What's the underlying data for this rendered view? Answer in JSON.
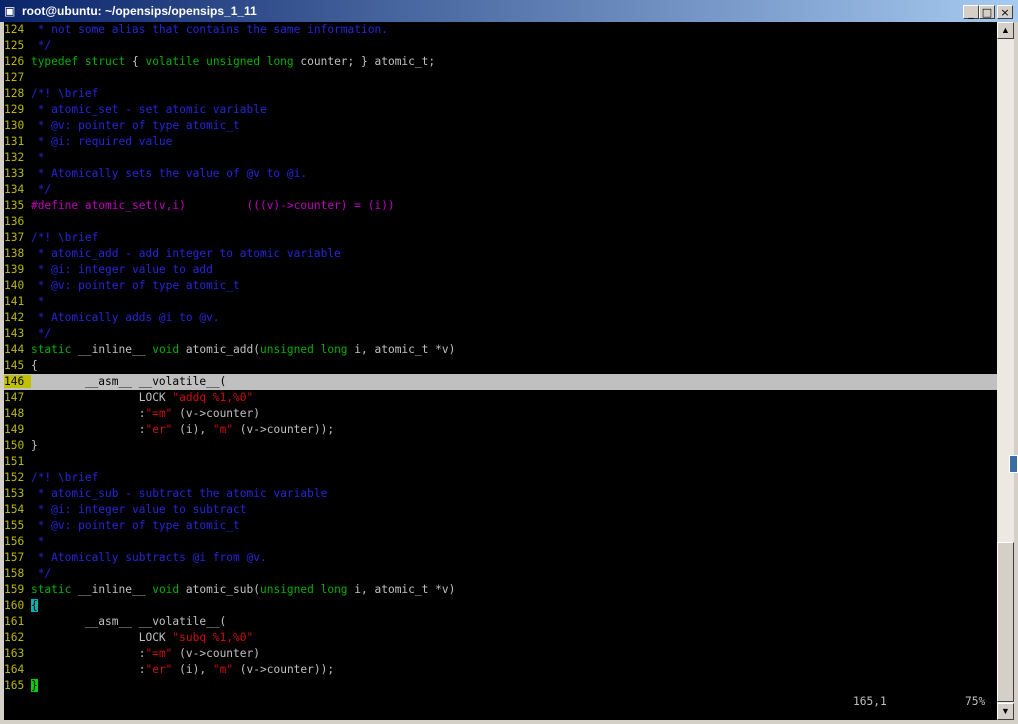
{
  "window": {
    "title": "root@ubuntu: ~/opensips/opensips_1_11",
    "icon": "terminal-icon",
    "buttons": {
      "minimize": "_",
      "maximize": "□",
      "close": "×"
    }
  },
  "editor": {
    "cursor_line": "146",
    "lines": [
      [
        [
          "124 ",
          "ln"
        ],
        [
          " * not some alias that contains the same information.",
          "c"
        ]
      ],
      [
        [
          "125 ",
          "ln"
        ],
        [
          " */",
          "c"
        ]
      ],
      [
        [
          "126 ",
          "ln"
        ],
        [
          "typedef struct",
          "k"
        ],
        [
          " { ",
          ""
        ],
        [
          "volatile unsigned long",
          "k"
        ],
        [
          " counter; } atomic_t;",
          ""
        ]
      ],
      [
        [
          "127 ",
          "ln"
        ]
      ],
      [
        [
          "128 ",
          "ln"
        ],
        [
          "/*! \\brief",
          "c"
        ]
      ],
      [
        [
          "129 ",
          "ln"
        ],
        [
          " * atomic_set - set atomic variable",
          "c"
        ]
      ],
      [
        [
          "130 ",
          "ln"
        ],
        [
          " * @v: pointer of type atomic_t",
          "c"
        ]
      ],
      [
        [
          "131 ",
          "ln"
        ],
        [
          " * @i: required value",
          "c"
        ]
      ],
      [
        [
          "132 ",
          "ln"
        ],
        [
          " *",
          "c"
        ]
      ],
      [
        [
          "133 ",
          "ln"
        ],
        [
          " * Atomically sets the value of @v to @i.",
          "c"
        ]
      ],
      [
        [
          "134 ",
          "ln"
        ],
        [
          " */",
          "c"
        ]
      ],
      [
        [
          "135 ",
          "ln"
        ],
        [
          "#define atomic_set(v,i)         (((v)->counter) = (i))",
          "p"
        ]
      ],
      [
        [
          "136 ",
          "ln"
        ]
      ],
      [
        [
          "137 ",
          "ln"
        ],
        [
          "/*! \\brief",
          "c"
        ]
      ],
      [
        [
          "138 ",
          "ln"
        ],
        [
          " * atomic_add - add integer to atomic variable",
          "c"
        ]
      ],
      [
        [
          "139 ",
          "ln"
        ],
        [
          " * @i: integer value to add",
          "c"
        ]
      ],
      [
        [
          "140 ",
          "ln"
        ],
        [
          " * @v: pointer of type atomic_t",
          "c"
        ]
      ],
      [
        [
          "141 ",
          "ln"
        ],
        [
          " *",
          "c"
        ]
      ],
      [
        [
          "142 ",
          "ln"
        ],
        [
          " * Atomically adds @i to @v.",
          "c"
        ]
      ],
      [
        [
          "143 ",
          "ln"
        ],
        [
          " */",
          "c"
        ]
      ],
      [
        [
          "144 ",
          "ln"
        ],
        [
          "static",
          "k"
        ],
        [
          " __inline__ ",
          ""
        ],
        [
          "void",
          "k"
        ],
        [
          " atomic_add(",
          ""
        ],
        [
          "unsigned long",
          "k"
        ],
        [
          " i, atomic_t *v)",
          ""
        ]
      ],
      [
        [
          "145 ",
          "ln"
        ],
        [
          "{",
          ""
        ]
      ],
      [
        [
          "146 ",
          "ln"
        ],
        [
          "        __asm__ __volatile__(",
          ""
        ]
      ],
      [
        [
          "147 ",
          "ln"
        ],
        [
          "                LOCK ",
          ""
        ],
        [
          "\"addq %1,%0\"",
          "s"
        ]
      ],
      [
        [
          "148 ",
          "ln"
        ],
        [
          "                :",
          ""
        ],
        [
          "\"=m\"",
          "s"
        ],
        [
          " (v->counter)",
          ""
        ]
      ],
      [
        [
          "149 ",
          "ln"
        ],
        [
          "                :",
          ""
        ],
        [
          "\"er\"",
          "s"
        ],
        [
          " (i), ",
          ""
        ],
        [
          "\"m\"",
          "s"
        ],
        [
          " (v->counter));",
          ""
        ]
      ],
      [
        [
          "150 ",
          "ln"
        ],
        [
          "}",
          ""
        ]
      ],
      [
        [
          "151 ",
          "ln"
        ]
      ],
      [
        [
          "152 ",
          "ln"
        ],
        [
          "/*! \\brief",
          "c"
        ]
      ],
      [
        [
          "153 ",
          "ln"
        ],
        [
          " * atomic_sub - subtract the atomic variable",
          "c"
        ]
      ],
      [
        [
          "154 ",
          "ln"
        ],
        [
          " * @i: integer value to subtract",
          "c"
        ]
      ],
      [
        [
          "155 ",
          "ln"
        ],
        [
          " * @v: pointer of type atomic_t",
          "c"
        ]
      ],
      [
        [
          "156 ",
          "ln"
        ],
        [
          " *",
          "c"
        ]
      ],
      [
        [
          "157 ",
          "ln"
        ],
        [
          " * Atomically subtracts @i from @v.",
          "c"
        ]
      ],
      [
        [
          "158 ",
          "ln"
        ],
        [
          " */",
          "c"
        ]
      ],
      [
        [
          "159 ",
          "ln"
        ],
        [
          "static",
          "k"
        ],
        [
          " __inline__ ",
          ""
        ],
        [
          "void",
          "k"
        ],
        [
          " atomic_sub(",
          ""
        ],
        [
          "unsigned long",
          "k"
        ],
        [
          " i, atomic_t *v)",
          ""
        ]
      ],
      [
        [
          "160 ",
          "ln"
        ],
        [
          "{",
          "cb1"
        ]
      ],
      [
        [
          "161 ",
          "ln"
        ],
        [
          "        __asm__ __volatile__(",
          ""
        ]
      ],
      [
        [
          "162 ",
          "ln"
        ],
        [
          "                LOCK ",
          ""
        ],
        [
          "\"subq %1,%0\"",
          "s"
        ]
      ],
      [
        [
          "163 ",
          "ln"
        ],
        [
          "                :",
          ""
        ],
        [
          "\"=m\"",
          "s"
        ],
        [
          " (v->counter)",
          ""
        ]
      ],
      [
        [
          "164 ",
          "ln"
        ],
        [
          "                :",
          ""
        ],
        [
          "\"er\"",
          "s"
        ],
        [
          " (i), ",
          ""
        ],
        [
          "\"m\"",
          "s"
        ],
        [
          " (v->counter));",
          ""
        ]
      ],
      [
        [
          "165 ",
          "ln"
        ],
        [
          "}",
          "cb2"
        ]
      ]
    ]
  },
  "statusline": {
    "position": "165,1",
    "percent": "75%"
  },
  "scrollbar": {
    "up_icon": "arrow-up-icon",
    "down_icon": "arrow-down-icon"
  },
  "colors": {
    "comment": "#2626d8",
    "keyword": "#00b300",
    "string": "#cc1010",
    "preproc": "#c000c0",
    "linenumber": "#b9b900",
    "cursorline": "#c0c0c0"
  }
}
